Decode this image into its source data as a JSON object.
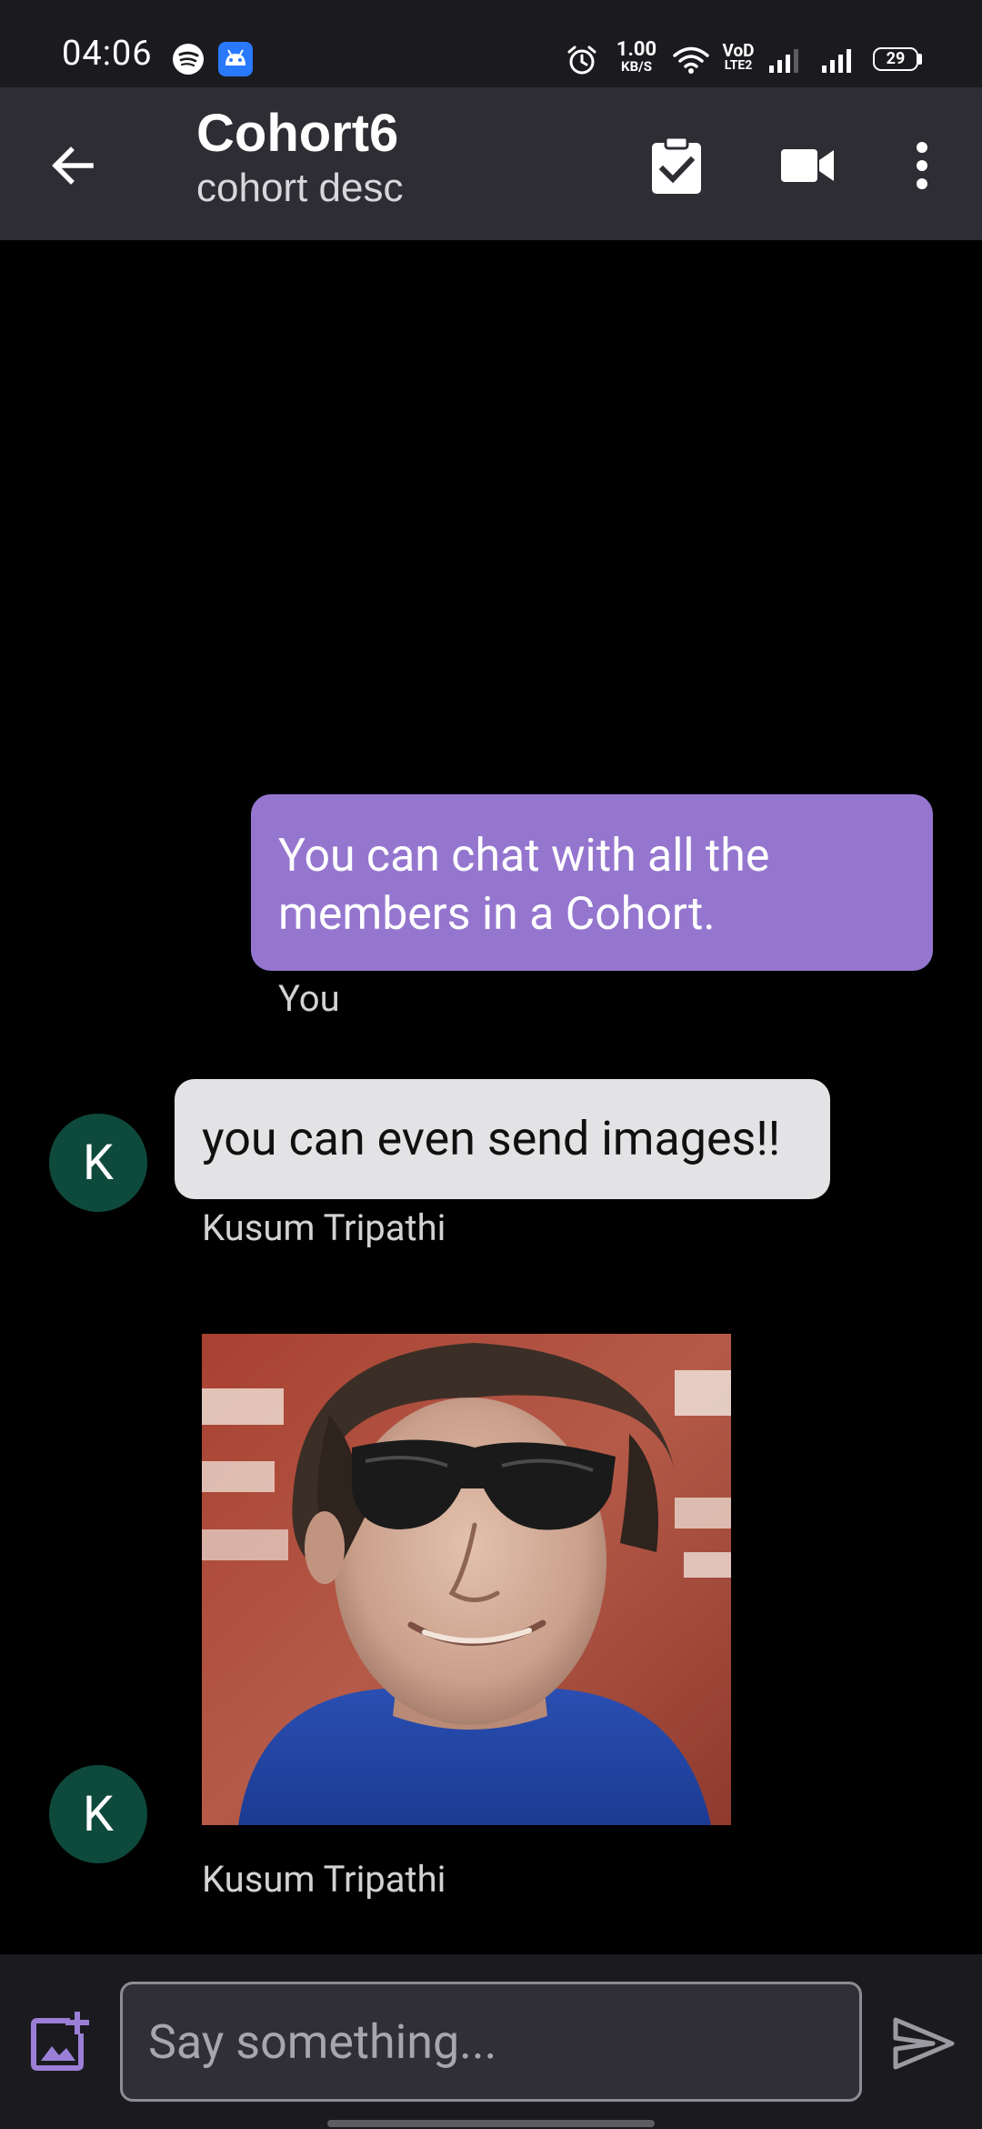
{
  "status_bar": {
    "time": "04:06",
    "net_speed_value": "1.00",
    "net_speed_unit": "KB/S",
    "volte_top": "VoD",
    "volte_bottom": "LTE2",
    "battery": "29",
    "icons": [
      "spotify-icon",
      "android-icon",
      "alarm-icon",
      "wifi-icon",
      "volte-icon",
      "signal-icon",
      "signal-icon",
      "battery-icon"
    ]
  },
  "header": {
    "title": "Cohort6",
    "subtitle": "cohort desc",
    "icons": [
      "back-arrow-icon",
      "clipboard-check-icon",
      "video-camera-icon",
      "more-vert-icon"
    ]
  },
  "messages": [
    {
      "type": "text",
      "direction": "sent",
      "text": "You can chat with all the members in a Cohort.",
      "sender": "You"
    },
    {
      "type": "text",
      "direction": "received",
      "text": "you can even send images!!",
      "sender": "Kusum Tripathi",
      "avatar_initial": "K"
    },
    {
      "type": "image",
      "direction": "received",
      "sender": "Kusum Tripathi",
      "avatar_initial": "K"
    }
  ],
  "composer": {
    "placeholder": "Say something...",
    "value": "",
    "icons": [
      "add-photo-icon",
      "send-icon"
    ]
  },
  "colors": {
    "status_bar_bg": "#1b1b1f",
    "app_bar_bg": "#2d2d33",
    "chat_bg": "#000000",
    "sent_bubble": "#9576cf",
    "received_bubble": "#e3e3e5",
    "avatar_bg": "#0e4a3c",
    "accent": "#9b7fd6"
  }
}
